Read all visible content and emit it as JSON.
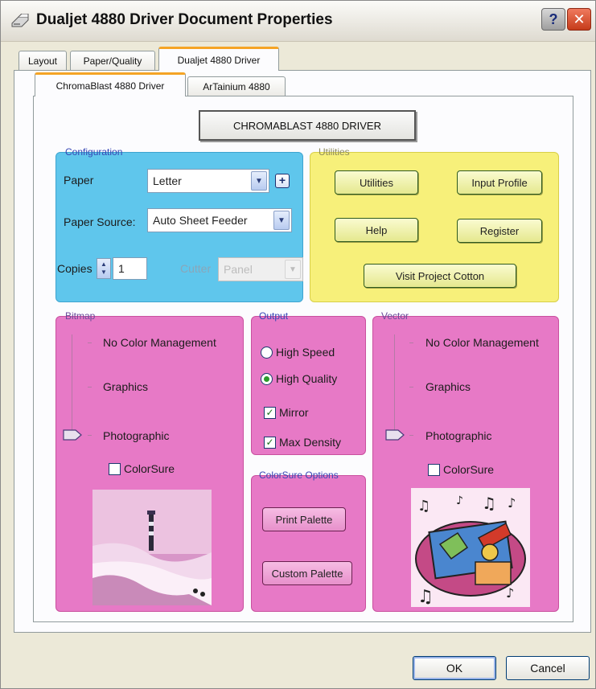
{
  "window": {
    "title": "Dualjet 4880 Driver Document Properties",
    "help_glyph": "?",
    "close_glyph": "✕"
  },
  "outer_tabs": [
    {
      "label": "Layout",
      "active": false
    },
    {
      "label": "Paper/Quality",
      "active": false
    },
    {
      "label": "Dualjet 4880 Driver",
      "active": true
    }
  ],
  "inner_tabs": [
    {
      "label": "ChromaBlast 4880 Driver",
      "active": true
    },
    {
      "label": "ArTainium 4880",
      "active": false
    }
  ],
  "main_button": "CHROMABLAST 4880 DRIVER",
  "configuration": {
    "legend": "Configuration",
    "paper_label": "Paper",
    "paper_value": "Letter",
    "source_label": "Paper Source:",
    "source_value": "Auto Sheet Feeder",
    "copies_label": "Copies",
    "copies_value": "1",
    "cutter_label": "Cutter",
    "cutter_value": "Panel"
  },
  "utilities": {
    "legend": "Utilities",
    "utilities_btn": "Utilities",
    "input_profile_btn": "Input Profile",
    "help_btn": "Help",
    "register_btn": "Register",
    "project_cotton_btn": "Visit Project Cotton"
  },
  "bitmap": {
    "legend": "Bitmap",
    "levels": [
      "No Color Management",
      "Graphics",
      "Photographic"
    ],
    "selected": "Photographic",
    "colorsure_label": "ColorSure",
    "colorsure_checked": false
  },
  "output": {
    "legend": "Output",
    "high_speed": "High Speed",
    "high_quality": "High Quality",
    "selected": "High Quality",
    "mirror": "Mirror",
    "mirror_checked": true,
    "max_density": "Max Density",
    "max_density_checked": true
  },
  "colorsure_options": {
    "legend": "ColorSure Options",
    "print_palette": "Print Palette",
    "custom_palette": "Custom Palette"
  },
  "vector": {
    "legend": "Vector",
    "levels": [
      "No Color Management",
      "Graphics",
      "Photographic"
    ],
    "selected": "Photographic",
    "colorsure_label": "ColorSure",
    "colorsure_checked": false
  },
  "footer": {
    "ok": "OK",
    "cancel": "Cancel"
  },
  "colors": {
    "configuration_bg": "#5fc6ec",
    "utilities_bg": "#f7f07a",
    "pink_bg": "#e779c6",
    "active_tab_accent": "#f5a425"
  },
  "icons": {
    "title": "printer-icon",
    "dropdown": "chevron-down-icon",
    "spinner": "spin-up-down-icon",
    "slider": "slider-thumb-icon"
  }
}
